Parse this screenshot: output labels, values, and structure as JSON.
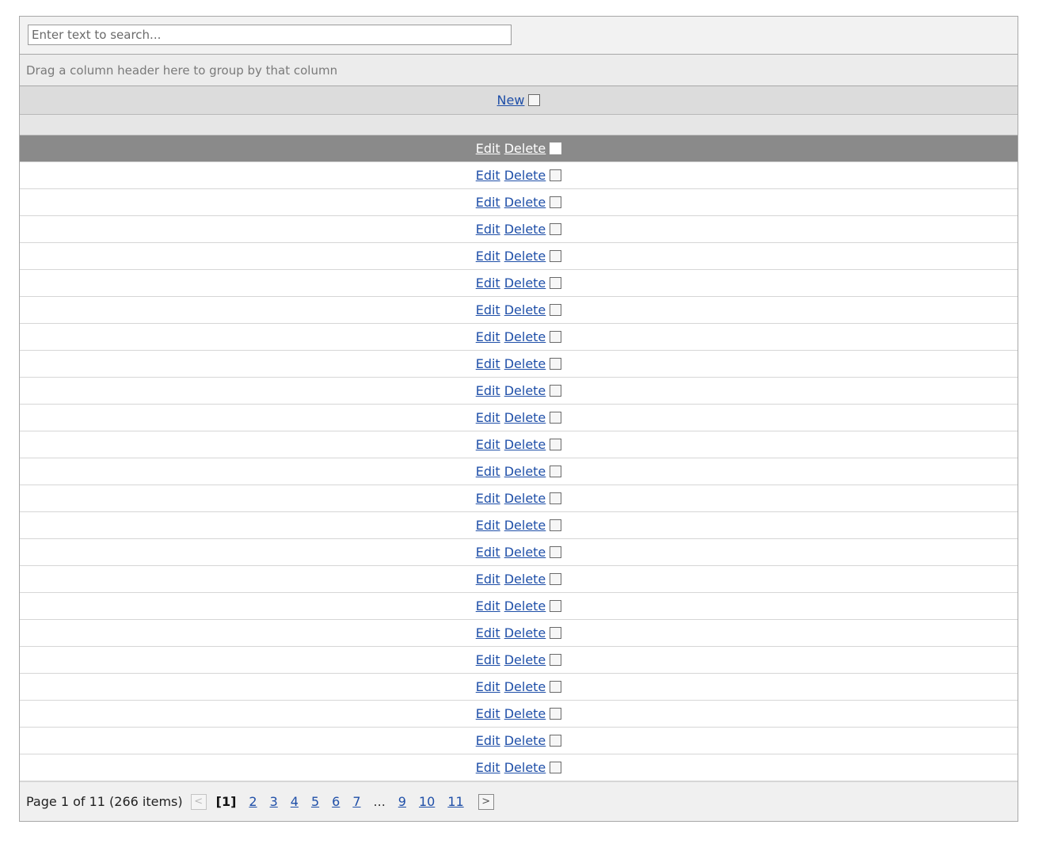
{
  "search": {
    "placeholder": "Enter text to search...",
    "value": ""
  },
  "group_panel": {
    "text": "Drag a column header here to group by that column"
  },
  "header": {
    "new_label": "New"
  },
  "rows": {
    "edit_label": "Edit",
    "delete_label": "Delete",
    "count": 24,
    "focused_index": 0
  },
  "pager": {
    "summary": "Page 1 of 11 (266 items)",
    "prev_icon": "chevron-left-icon",
    "next_icon": "chevron-right-icon",
    "prev_glyph": "<",
    "next_glyph": ">",
    "current": "[1]",
    "pages": [
      "2",
      "3",
      "4",
      "5",
      "6",
      "7"
    ],
    "ellipsis": "...",
    "tail_pages": [
      "9",
      "10",
      "11"
    ]
  },
  "colors": {
    "link": "#1f4fa8",
    "focused_row": "#8a8a8a",
    "header_bg": "#dcdcdc",
    "border": "#a8a8a8"
  }
}
